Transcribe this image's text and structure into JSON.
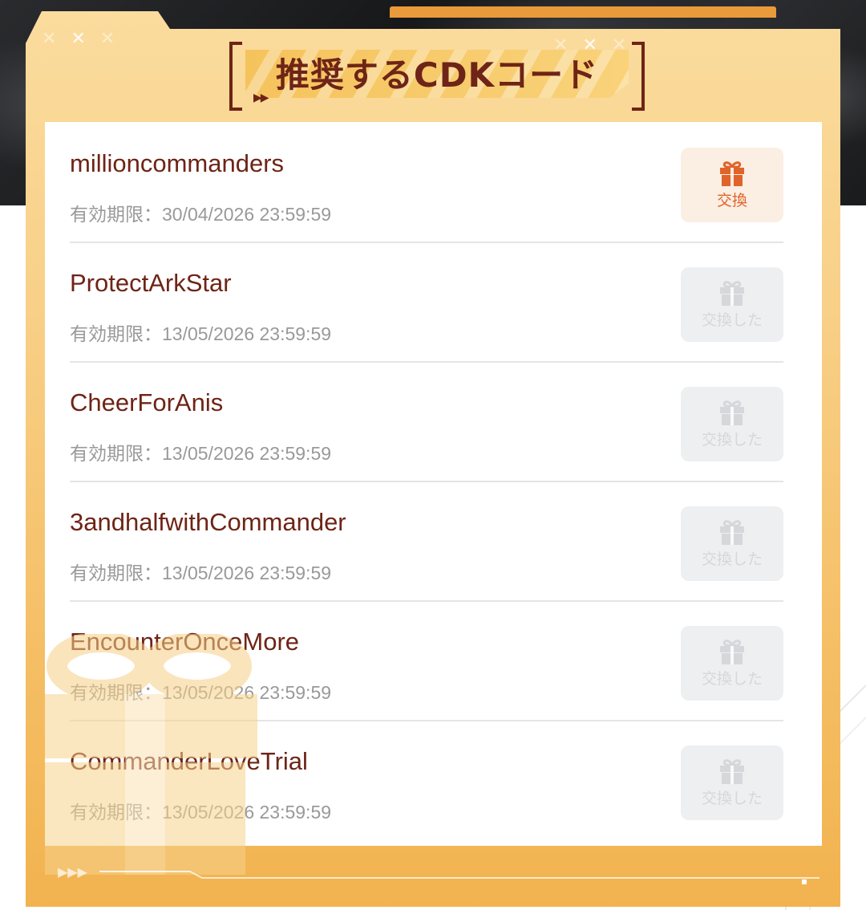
{
  "title": "推奨するCDKコード",
  "colors": {
    "accent": "#e0642a",
    "title": "#6e2416",
    "code_text": "#6e2416",
    "muted": "#999999",
    "panel_top": "#fbdc9e",
    "panel_bottom": "#f2b34f"
  },
  "codes": [
    {
      "code": "millioncommanders",
      "expiry": "有効期限：30/04/2026 23:59:59",
      "button": "交換",
      "state": "available",
      "icon": "gift-icon"
    },
    {
      "code": "ProtectArkStar",
      "expiry": "有効期限：13/05/2026 23:59:59",
      "button": "交換した",
      "state": "redeemed",
      "icon": "gift-icon"
    },
    {
      "code": "CheerForAnis",
      "expiry": "有効期限：13/05/2026 23:59:59",
      "button": "交換した",
      "state": "redeemed",
      "icon": "gift-icon"
    },
    {
      "code": "3andhalfwithCommander",
      "expiry": "有効期限：13/05/2026 23:59:59",
      "button": "交換した",
      "state": "redeemed",
      "icon": "gift-icon"
    },
    {
      "code": "EncounterOnceMore",
      "expiry": "有効期限：13/05/2026 23:59:59",
      "button": "交換した",
      "state": "redeemed",
      "icon": "gift-icon"
    },
    {
      "code": "CommanderLoveTrial",
      "expiry": "有効期限：13/05/2026 23:59:59",
      "button": "交換した",
      "state": "redeemed",
      "icon": "gift-icon"
    }
  ]
}
